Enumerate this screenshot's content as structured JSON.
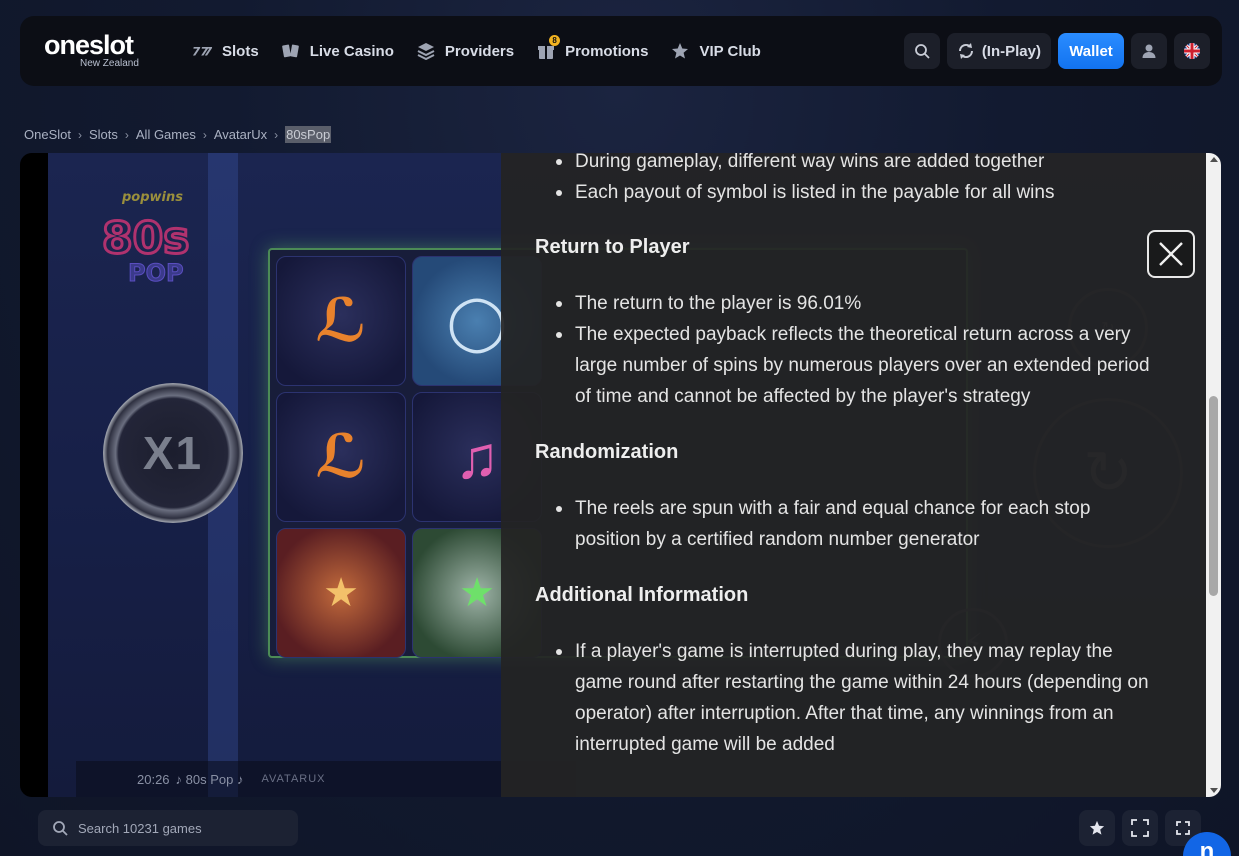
{
  "header": {
    "logo": {
      "name": "oneslot",
      "region": "New Zealand"
    },
    "nav": [
      {
        "label": "Slots",
        "icon": "slots-777-icon"
      },
      {
        "label": "Live Casino",
        "icon": "cards-icon"
      },
      {
        "label": "Providers",
        "icon": "layers-icon"
      },
      {
        "label": "Promotions",
        "icon": "gift-icon",
        "badge": "8"
      },
      {
        "label": "VIP Club",
        "icon": "crown-icon"
      }
    ],
    "in_play_label": "(In-Play)",
    "wallet_label": "Wallet",
    "language_flag": "gb-flag-icon"
  },
  "breadcrumb": [
    "OneSlot",
    "Slots",
    "All Games",
    "AvatarUx",
    "80sPop"
  ],
  "game": {
    "bottom_bar": {
      "time": "20:26",
      "title": "♪ 80s Pop ♪",
      "provider": "AVATARUX"
    },
    "multiplier": "X1",
    "logo_text": "80s",
    "logo_sub": "POP",
    "logo_top": "popwins"
  },
  "info_panel": {
    "intro_bullets": [
      "During gameplay, different way wins are added together",
      "Each payout of symbol is listed in the payable for all wins"
    ],
    "sections": [
      {
        "title": "Return to Player",
        "bullets": [
          "The return to the player is 96.01%",
          "The expected payback reflects the theoretical return across a very large number of spins by numerous players over an extended period of time and cannot be affected by the player's strategy"
        ]
      },
      {
        "title": "Randomization",
        "bullets": [
          "The reels are spun with a fair and equal chance for each stop position by a certified random number generator"
        ]
      },
      {
        "title": "Additional Information",
        "bullets": [
          "If a player's game is interrupted during play, they may replay the game round after restarting the game within 24 hours (depending on operator) after interruption. After that time, any winnings from an interrupted game will be added"
        ]
      }
    ],
    "scroll_position": 0.55
  },
  "footer": {
    "search_placeholder": "Search 10231 games",
    "buttons": [
      "favorite-star-icon",
      "fullscreen-icon",
      "expand-icon"
    ],
    "chat_label": "n"
  },
  "colors": {
    "accent": "#1273f0",
    "reel_border": "#78e66e",
    "page_bg": "#121a30"
  }
}
